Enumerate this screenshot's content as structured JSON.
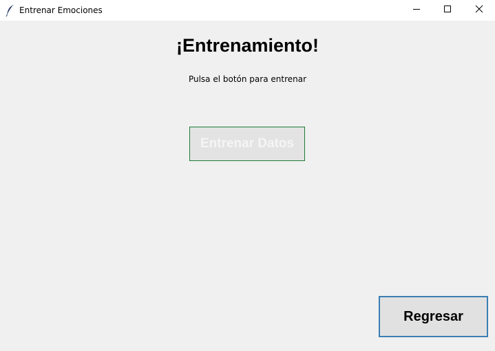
{
  "window": {
    "title": "Entrenar Emociones",
    "app_icon": "feather-icon",
    "controls": {
      "minimize_icon": "minimize-icon",
      "maximize_icon": "maximize-icon",
      "close_icon": "close-icon"
    }
  },
  "main": {
    "heading": "¡Entrenamiento!",
    "subtitle": "Pulsa el botón para entrenar",
    "train_button_label": "Entrenar Datos",
    "back_button_label": "Regresar"
  },
  "colors": {
    "background": "#f0f0f0",
    "titlebar": "#ffffff",
    "train_button_border": "#1f7a33",
    "back_button_border": "#3a7eb5"
  }
}
